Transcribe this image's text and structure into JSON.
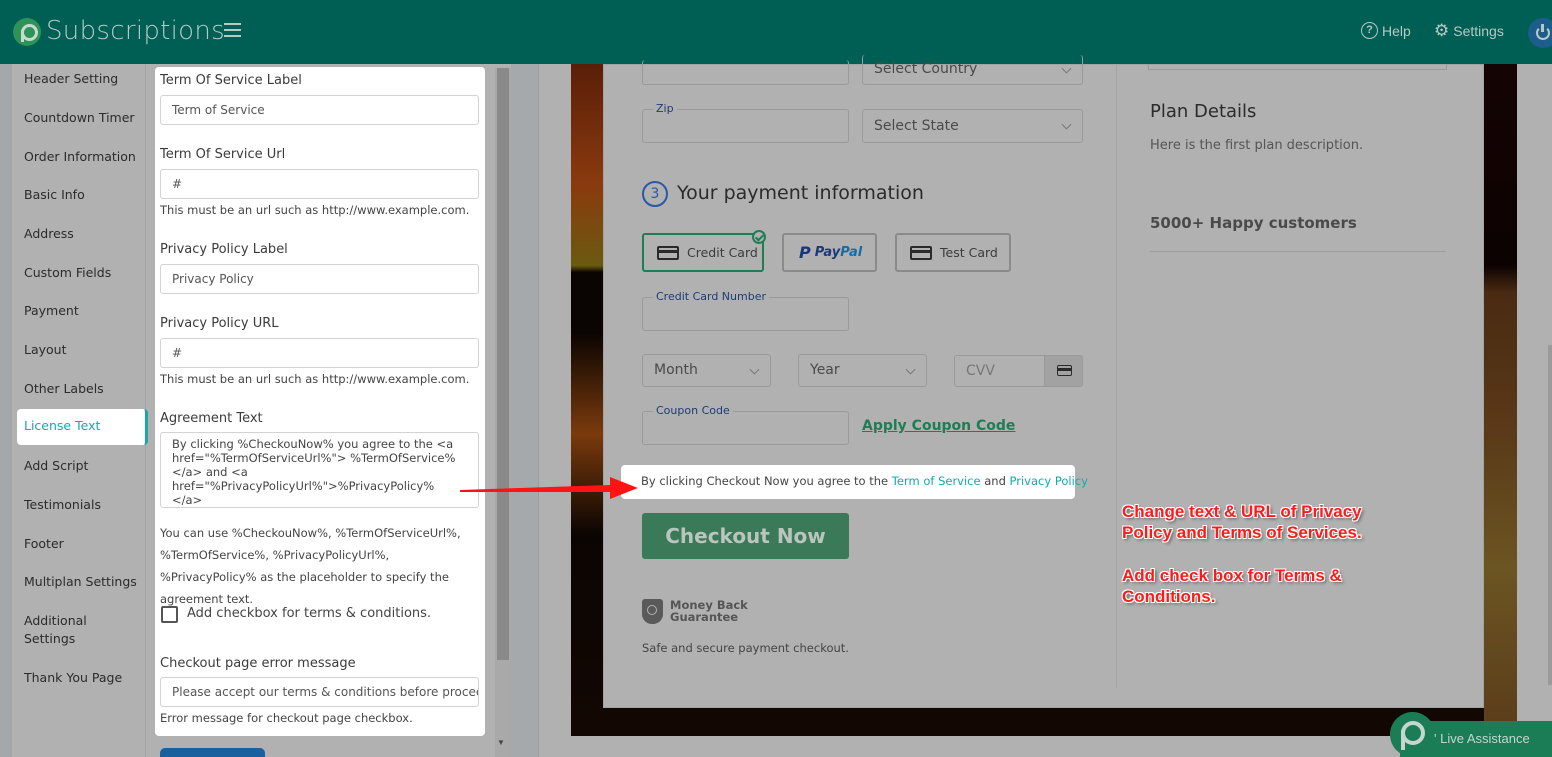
{
  "header": {
    "app_title": "Subscriptions",
    "help_label": "Help",
    "settings_label": "Settings"
  },
  "sidebar": {
    "active": "License Text",
    "items": [
      {
        "label": "Header Setting"
      },
      {
        "label": "Countdown Timer"
      },
      {
        "label": "Order Information"
      },
      {
        "label": "Basic Info"
      },
      {
        "label": "Address"
      },
      {
        "label": "Custom Fields"
      },
      {
        "label": "Payment"
      },
      {
        "label": "Layout"
      },
      {
        "label": "Other Labels"
      },
      {
        "label": "License Text"
      },
      {
        "label": "Add Script"
      },
      {
        "label": "Testimonials"
      },
      {
        "label": "Footer"
      },
      {
        "label": "Multiplan Settings"
      },
      {
        "label": "Additional Settings"
      },
      {
        "label": "Thank You Page"
      }
    ]
  },
  "form": {
    "tos_label": {
      "label": "Term Of Service Label",
      "value": "Term of Service"
    },
    "tos_url": {
      "label": "Term Of Service Url",
      "value": "#",
      "help": "This must be an url such as http://www.example.com."
    },
    "pp_label": {
      "label": "Privacy Policy Label",
      "value": "Privacy Policy"
    },
    "pp_url": {
      "label": "Privacy Policy URL",
      "value": "#",
      "help": "This must be an url such as http://www.example.com."
    },
    "agreement": {
      "label": "Agreement Text",
      "value": "By clicking %CheckouNow% you agree to the <a href=\"%TermOfServiceUrl%\"> %TermOfService% </a> and <a href=\"%PrivacyPolicyUrl%\">%PrivacyPolicy% </a>",
      "note": "You can use %CheckouNow%, %TermOfServiceUrl%, %TermOfService%, %PrivacyPolicyUrl%, %PrivacyPolicy% as the placeholder to specify the agreement text."
    },
    "checkbox": {
      "label": "Add checkbox for terms & conditions.",
      "checked": false
    },
    "error_message": {
      "label": "Checkout page error message",
      "value": "Please accept our terms & conditions before proceedin",
      "help": "Error message for checkout page checkbox."
    }
  },
  "preview": {
    "country_placeholder": "Select Country",
    "zip_label": "Zip",
    "state_placeholder": "Select State",
    "step_number": "3",
    "step_title": "Your payment information",
    "payment_options": [
      {
        "label": "Credit Card",
        "selected": true
      },
      {
        "label": "PayPal",
        "selected": false
      },
      {
        "label": "Test Card",
        "selected": false
      }
    ],
    "paypal_pay": "Pay",
    "paypal_pal": "Pal",
    "card_number_label": "Credit Card Number",
    "month_placeholder": "Month",
    "year_placeholder": "Year",
    "cvv_placeholder": "CVV",
    "coupon_label": "Coupon Code",
    "apply_coupon": "Apply Coupon Code",
    "agreement": {
      "prefix": "By clicking Checkout Now you agree to the ",
      "tos_link": "Term of Service",
      "middle": " and ",
      "pp_link": "Privacy Policy"
    },
    "checkout_button": "Checkout Now",
    "money_back_line1": "Money Back",
    "money_back_line2": "Guarantee",
    "safe_text": "Safe and secure payment checkout.",
    "plan_title": "Plan Details",
    "plan_description": "Here is the first plan description.",
    "happy_customers": "5000+ Happy customers"
  },
  "annotation": {
    "line1": "Change text & URL of Privacy Policy and Terms of Services.",
    "line2": "Add check box for Terms & Conditions."
  },
  "live_assistance": {
    "label": "' Live Assistance"
  },
  "colors": {
    "topbar": "#005f55",
    "accent_teal": "#17a7ad",
    "checkout_green": "#3a7a58",
    "annotation_red": "#ff1a1a"
  }
}
